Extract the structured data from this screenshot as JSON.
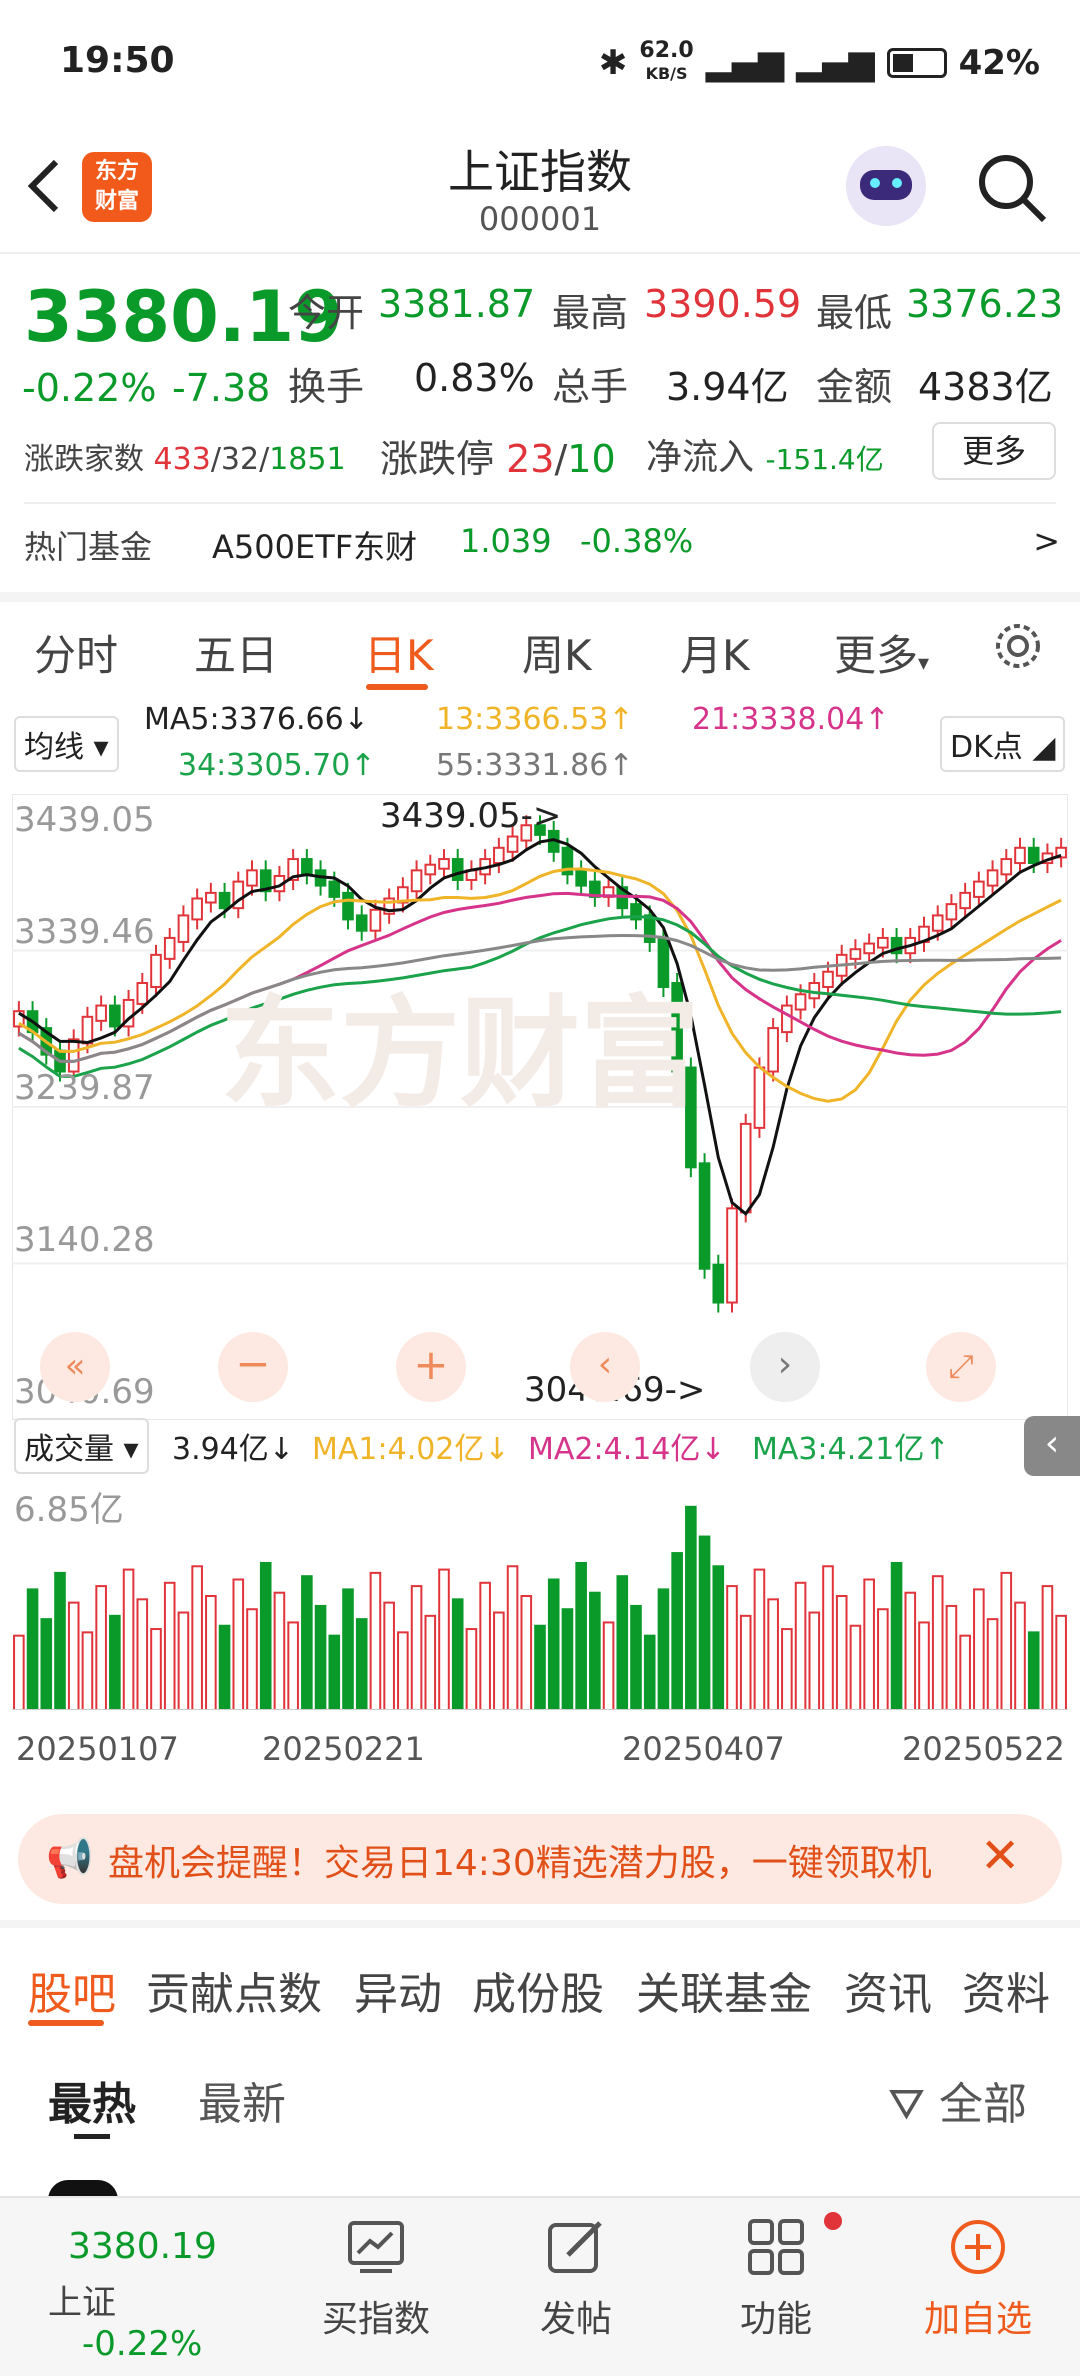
{
  "status": {
    "time": "19:50",
    "net_speed": "62.0",
    "net_unit": "KB/S",
    "battery": "42%"
  },
  "header": {
    "title": "上证指数",
    "code": "000001",
    "logo_line1": "东方",
    "logo_line2": "财富"
  },
  "quote": {
    "price": "3380.19",
    "change_pct": "-0.22%",
    "change": "-7.38",
    "open_label": "今开",
    "open": "3381.87",
    "high_label": "最高",
    "high": "3390.59",
    "low_label": "最低",
    "low": "3376.23",
    "turnover_label": "换手",
    "turnover": "0.83%",
    "volume_label": "总手",
    "volume": "3.94亿",
    "amount_label": "金额",
    "amount": "4383亿",
    "breadth_label": "涨跌家数",
    "breadth_up": "433",
    "breadth_flat": "32",
    "breadth_down": "1851",
    "limit_label": "涨跌停",
    "limit_up": "23",
    "limit_down": "10",
    "inflow_label": "净流入",
    "inflow": "-151.4亿",
    "more": "更多",
    "fund_label": "热门基金",
    "fund_name": "A500ETF东财",
    "fund_price": "1.039",
    "fund_pct": "-0.38%",
    "fund_arrow": ">"
  },
  "ktabs": [
    "分时",
    "五日",
    "日K",
    "周K",
    "月K",
    "更多"
  ],
  "chart": {
    "ma_select": "均线",
    "ma5": "MA5:3376.66↓",
    "ma13": "13:3366.53↑",
    "ma21": "21:3338.04↑",
    "ma34": "34:3305.70↑",
    "ma55": "55:3331.86↑",
    "dk": "DK点",
    "price_labels": [
      "3439.05",
      "3339.46",
      "3239.87",
      "3140.28",
      "3040.69"
    ],
    "max_marker": "3439.05->",
    "min_marker": "3040.69->",
    "vol_select": "成交量",
    "vol": "3.94亿↓",
    "vma1": "MA1:4.02亿↓",
    "vma2": "MA2:4.14亿↓",
    "vma3": "MA3:4.21亿↑",
    "vol_max": "6.85亿",
    "dates": [
      "20250107",
      "20250221",
      "20250407",
      "20250522"
    ],
    "watermark": "东方财富",
    "colors": {
      "up": "#e0343a",
      "down": "#0a9a2a",
      "ma5": "#111111",
      "ma13": "#f0b429",
      "ma21": "#d6338a",
      "ma34": "#1aa34a",
      "ma55": "#888888"
    }
  },
  "notice": {
    "text": "盘机会提醒！交易日14:30精选潜力股，一键领取机"
  },
  "ctabs": [
    "股吧",
    "贡献点数",
    "异动",
    "成份股",
    "关联基金",
    "资讯",
    "资料"
  ],
  "subtabs": {
    "hot": "最热",
    "latest": "最新",
    "filter": "全部"
  },
  "bottom": {
    "price": "3380.19",
    "name": "上证",
    "pct": "-0.22%",
    "items": [
      {
        "label": "买指数",
        "icon": "chart-icon"
      },
      {
        "label": "发帖",
        "icon": "edit-icon"
      },
      {
        "label": "功能",
        "icon": "grid-icon"
      },
      {
        "label": "加自选",
        "icon": "add-icon"
      }
    ]
  }
}
